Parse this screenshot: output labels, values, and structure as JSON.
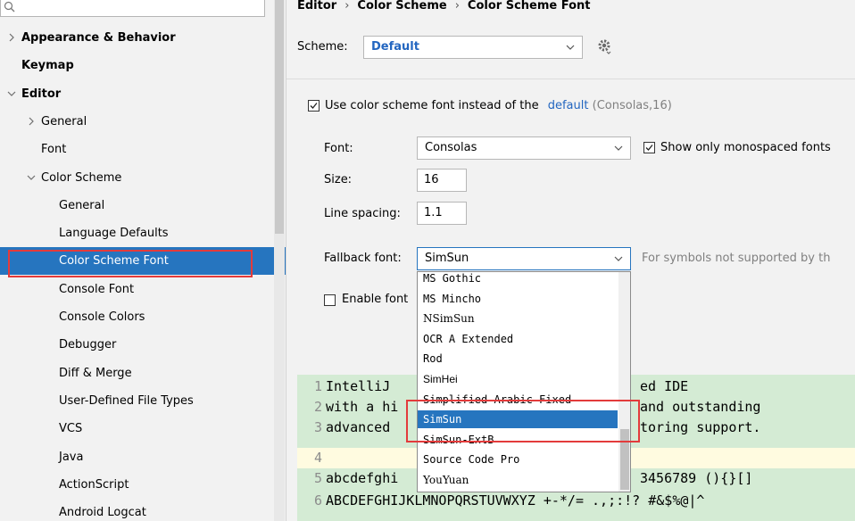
{
  "sidebar": {
    "search": {
      "value": "",
      "placeholder": ""
    },
    "items": [
      {
        "label": "Appearance & Behavior",
        "level": 0,
        "bold": true,
        "chevron": "right"
      },
      {
        "label": "Keymap",
        "level": 0,
        "bold": true,
        "chevron": "none"
      },
      {
        "label": "Editor",
        "level": 0,
        "bold": true,
        "chevron": "down"
      },
      {
        "label": "General",
        "level": 1,
        "bold": false,
        "chevron": "right"
      },
      {
        "label": "Font",
        "level": 1,
        "bold": false,
        "chevron": "none"
      },
      {
        "label": "Color Scheme",
        "level": 1,
        "bold": false,
        "chevron": "down"
      },
      {
        "label": "General",
        "level": 2,
        "bold": false,
        "chevron": "none"
      },
      {
        "label": "Language Defaults",
        "level": 2,
        "bold": false,
        "chevron": "none"
      },
      {
        "label": "Color Scheme Font",
        "level": 2,
        "bold": false,
        "chevron": "none",
        "selected": true
      },
      {
        "label": "Console Font",
        "level": 2,
        "bold": false,
        "chevron": "none"
      },
      {
        "label": "Console Colors",
        "level": 2,
        "bold": false,
        "chevron": "none"
      },
      {
        "label": "Debugger",
        "level": 2,
        "bold": false,
        "chevron": "none"
      },
      {
        "label": "Diff & Merge",
        "level": 2,
        "bold": false,
        "chevron": "none"
      },
      {
        "label": "User-Defined File Types",
        "level": 2,
        "bold": false,
        "chevron": "none"
      },
      {
        "label": "VCS",
        "level": 2,
        "bold": false,
        "chevron": "none"
      },
      {
        "label": "Java",
        "level": 2,
        "bold": false,
        "chevron": "none"
      },
      {
        "label": "ActionScript",
        "level": 2,
        "bold": false,
        "chevron": "none"
      },
      {
        "label": "Android Logcat",
        "level": 2,
        "bold": false,
        "chevron": "none"
      }
    ]
  },
  "breadcrumb": [
    "Editor",
    "Color Scheme",
    "Color Scheme Font"
  ],
  "breadcrumb_sep": "›",
  "scheme": {
    "label": "Scheme:",
    "value": "Default"
  },
  "use_scheme_font": {
    "checked": true,
    "label": "Use color scheme font instead of the",
    "link": "default",
    "suffix": "(Consolas,16)"
  },
  "font": {
    "label": "Font:",
    "value": "Consolas"
  },
  "show_mono": {
    "checked": true,
    "label": "Show only monospaced fonts"
  },
  "size": {
    "label": "Size:",
    "value": "16"
  },
  "line_spacing": {
    "label": "Line spacing:",
    "value": "1.1"
  },
  "fallback": {
    "label": "Fallback font:",
    "value": "SimSun",
    "hint": "For symbols not supported by th"
  },
  "ligatures": {
    "checked": false,
    "label": "Enable font"
  },
  "fallback_options": [
    {
      "label": "MS Gothic",
      "selected": false
    },
    {
      "label": "MS Mincho",
      "selected": false
    },
    {
      "label": "NSimSun",
      "selected": false
    },
    {
      "label": "OCR A Extended",
      "selected": false
    },
    {
      "label": "Rod",
      "selected": false
    },
    {
      "label": "SimHei",
      "selected": false
    },
    {
      "label": "Simplified Arabic Fixed",
      "selected": false
    },
    {
      "label": "SimSun",
      "selected": true
    },
    {
      "label": "SimSun-ExtB",
      "selected": false
    },
    {
      "label": "Source Code Pro",
      "selected": false
    },
    {
      "label": "YouYuan",
      "selected": false
    }
  ],
  "preview_lines": [
    {
      "num": "1",
      "left": "IntelliJ",
      "right": "ed IDE"
    },
    {
      "num": "2",
      "left": "with a hi",
      "right": "and outstanding"
    },
    {
      "num": "3",
      "left": "advanced",
      "right": "toring support."
    },
    {
      "num": "4",
      "left": "",
      "right": ""
    },
    {
      "num": "5",
      "left": "abcdefghi",
      "right": "3456789 (){}[]"
    },
    {
      "num": "6",
      "left": "ABCDEFGHIJKLMNOPQRSTUVWXYZ +-*/= .,;:!? #&$%@|^",
      "right": ""
    }
  ],
  "colors": {
    "selection": "#2675bf",
    "highlight_box": "#e33b3b",
    "link": "#2366c0",
    "preview_bg": "#d4ebd4"
  }
}
